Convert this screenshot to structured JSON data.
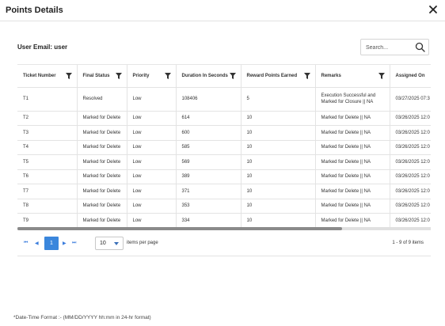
{
  "dialog": {
    "title": "Points Details",
    "close_icon": "close-icon"
  },
  "user_email": "User Email: user",
  "search": {
    "placeholder": "Search...",
    "value": "",
    "icon": "search-icon"
  },
  "grid": {
    "columns": [
      "Ticket Number",
      "Final Status",
      "Priority",
      "Duration In Seconds",
      "Reward Points Earned",
      "Remarks",
      "Assigned On"
    ],
    "filter_icon": "filter-icon",
    "rows": [
      [
        "T1",
        "Resolved",
        "Low",
        "108406",
        "5",
        "Execution Successful and Marked for Closure || NA",
        "03/27/2025 07:3"
      ],
      [
        "T2",
        "Marked for Delete",
        "Low",
        "614",
        "10",
        "Marked for Delete || NA",
        "03/26/2025 12:0"
      ],
      [
        "T3",
        "Marked for Delete",
        "Low",
        "600",
        "10",
        "Marked for Delete || NA",
        "03/26/2025 12:0"
      ],
      [
        "T4",
        "Marked for Delete",
        "Low",
        "585",
        "10",
        "Marked for Delete || NA",
        "03/26/2025 12:0"
      ],
      [
        "T5",
        "Marked for Delete",
        "Low",
        "569",
        "10",
        "Marked for Delete || NA",
        "03/26/2025 12:0"
      ],
      [
        "T6",
        "Marked for Delete",
        "Low",
        "389",
        "10",
        "Marked for Delete || NA",
        "03/26/2025 12:0"
      ],
      [
        "T7",
        "Marked for Delete",
        "Low",
        "371",
        "10",
        "Marked for Delete || NA",
        "03/26/2025 12:0"
      ],
      [
        "T8",
        "Marked for Delete",
        "Low",
        "353",
        "10",
        "Marked for Delete || NA",
        "03/26/2025 12:0"
      ],
      [
        "T9",
        "Marked for Delete",
        "Low",
        "334",
        "10",
        "Marked for Delete || NA",
        "03/26/2025 12:0"
      ]
    ]
  },
  "pager": {
    "first": "⏮",
    "prev": "◀",
    "current_page": "1",
    "next": "▶",
    "last": "⏭",
    "page_size": "10",
    "items_per_page": "items per page",
    "item_count": "1 - 9 of 9 items"
  },
  "footnote": "*Date-Time Format :- (MM/DD/YYYY hh:mm in 24-hr format)",
  "colors": {
    "accent": "#3a86dc",
    "border": "#e3e3e3"
  }
}
